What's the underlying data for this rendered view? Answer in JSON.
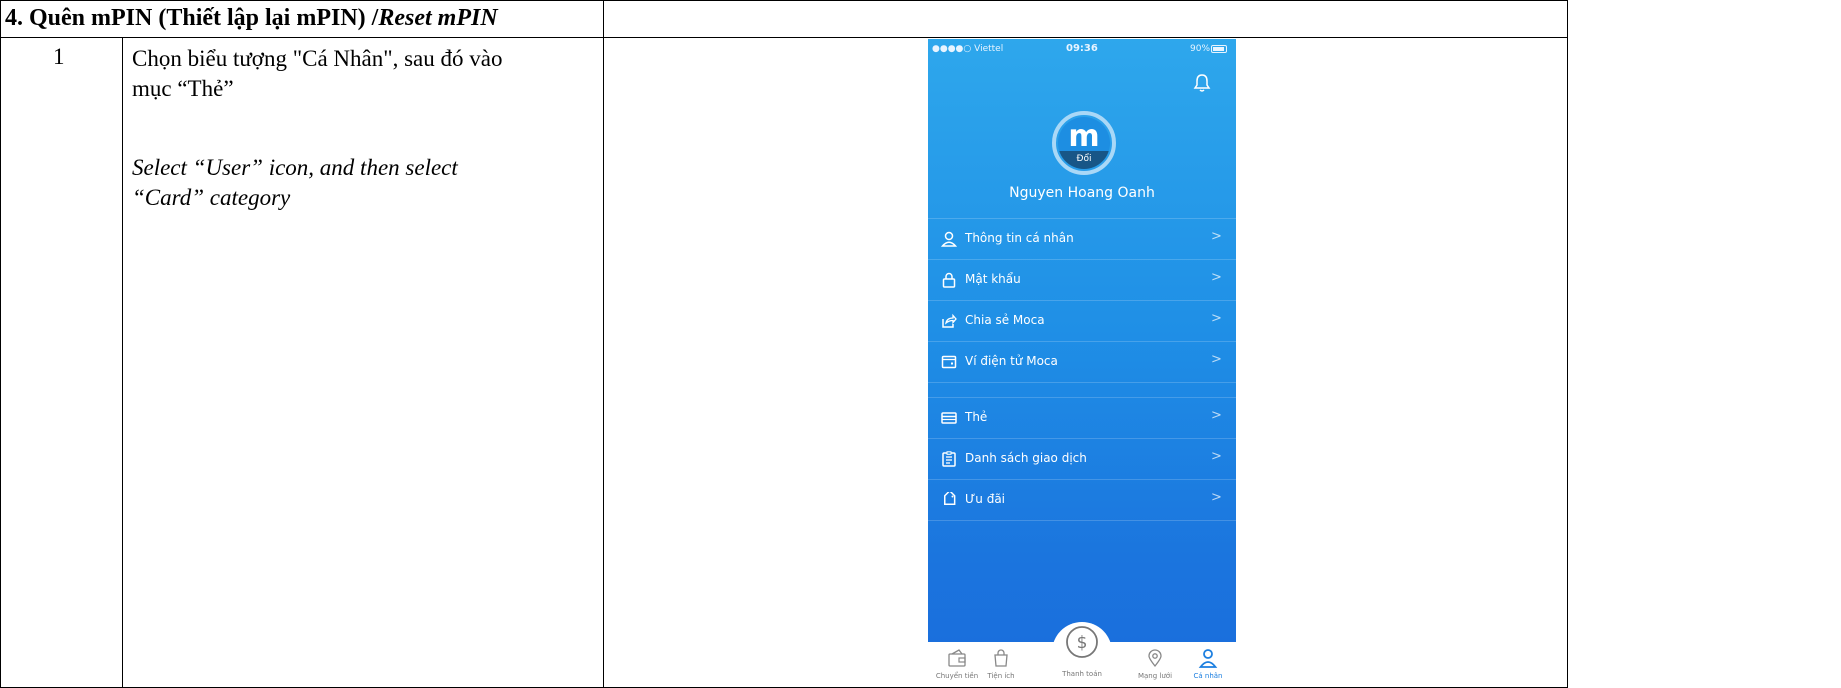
{
  "document": {
    "section_title": "4. Quên mPIN (Thiết lập lại mPIN) /",
    "section_title_en": "Reset mPIN",
    "step_number": "1",
    "step_text_vi_line1": "Chọn biểu tượng \"Cá Nhân\", sau đó vào",
    "step_text_vi_line2": "mục “Thẻ”",
    "step_text_en_line1": "Select “User” icon, and then select",
    "step_text_en_line2": "“Card” category"
  },
  "phone": {
    "status": {
      "carrier": "●●●●○ Viettel",
      "time": "09:36",
      "battery": "90%"
    },
    "avatar": {
      "letter": "m",
      "change_label": "Đổi"
    },
    "user_name": "Nguyen Hoang Oanh",
    "menu_group_1": [
      {
        "label": "Thông tin cá nhân",
        "icon": "user-icon"
      },
      {
        "label": "Mật khẩu",
        "icon": "lock-icon"
      },
      {
        "label": "Chia sẻ Moca",
        "icon": "share-icon"
      },
      {
        "label": "Ví điện tử Moca",
        "icon": "wallet-icon"
      }
    ],
    "menu_group_2": [
      {
        "label": "Thẻ",
        "icon": "card-icon"
      },
      {
        "label": "Danh sách giao dịch",
        "icon": "list-icon"
      },
      {
        "label": "Ưu đãi",
        "icon": "tag-icon"
      }
    ],
    "chevron": ">",
    "tabs": [
      {
        "label": "Chuyển tiền",
        "icon": "transfer-icon"
      },
      {
        "label": "Tiện ích",
        "icon": "bag-icon"
      },
      {
        "label": "Thanh toán",
        "icon": "dollar-icon"
      },
      {
        "label": "Mạng lưới",
        "icon": "location-icon"
      },
      {
        "label": "Cá nhân",
        "icon": "user-icon"
      }
    ],
    "colors": {
      "accent": "#1c7fe0",
      "background_top": "#2ea7ec",
      "background_bottom": "#1a6cdc"
    }
  }
}
